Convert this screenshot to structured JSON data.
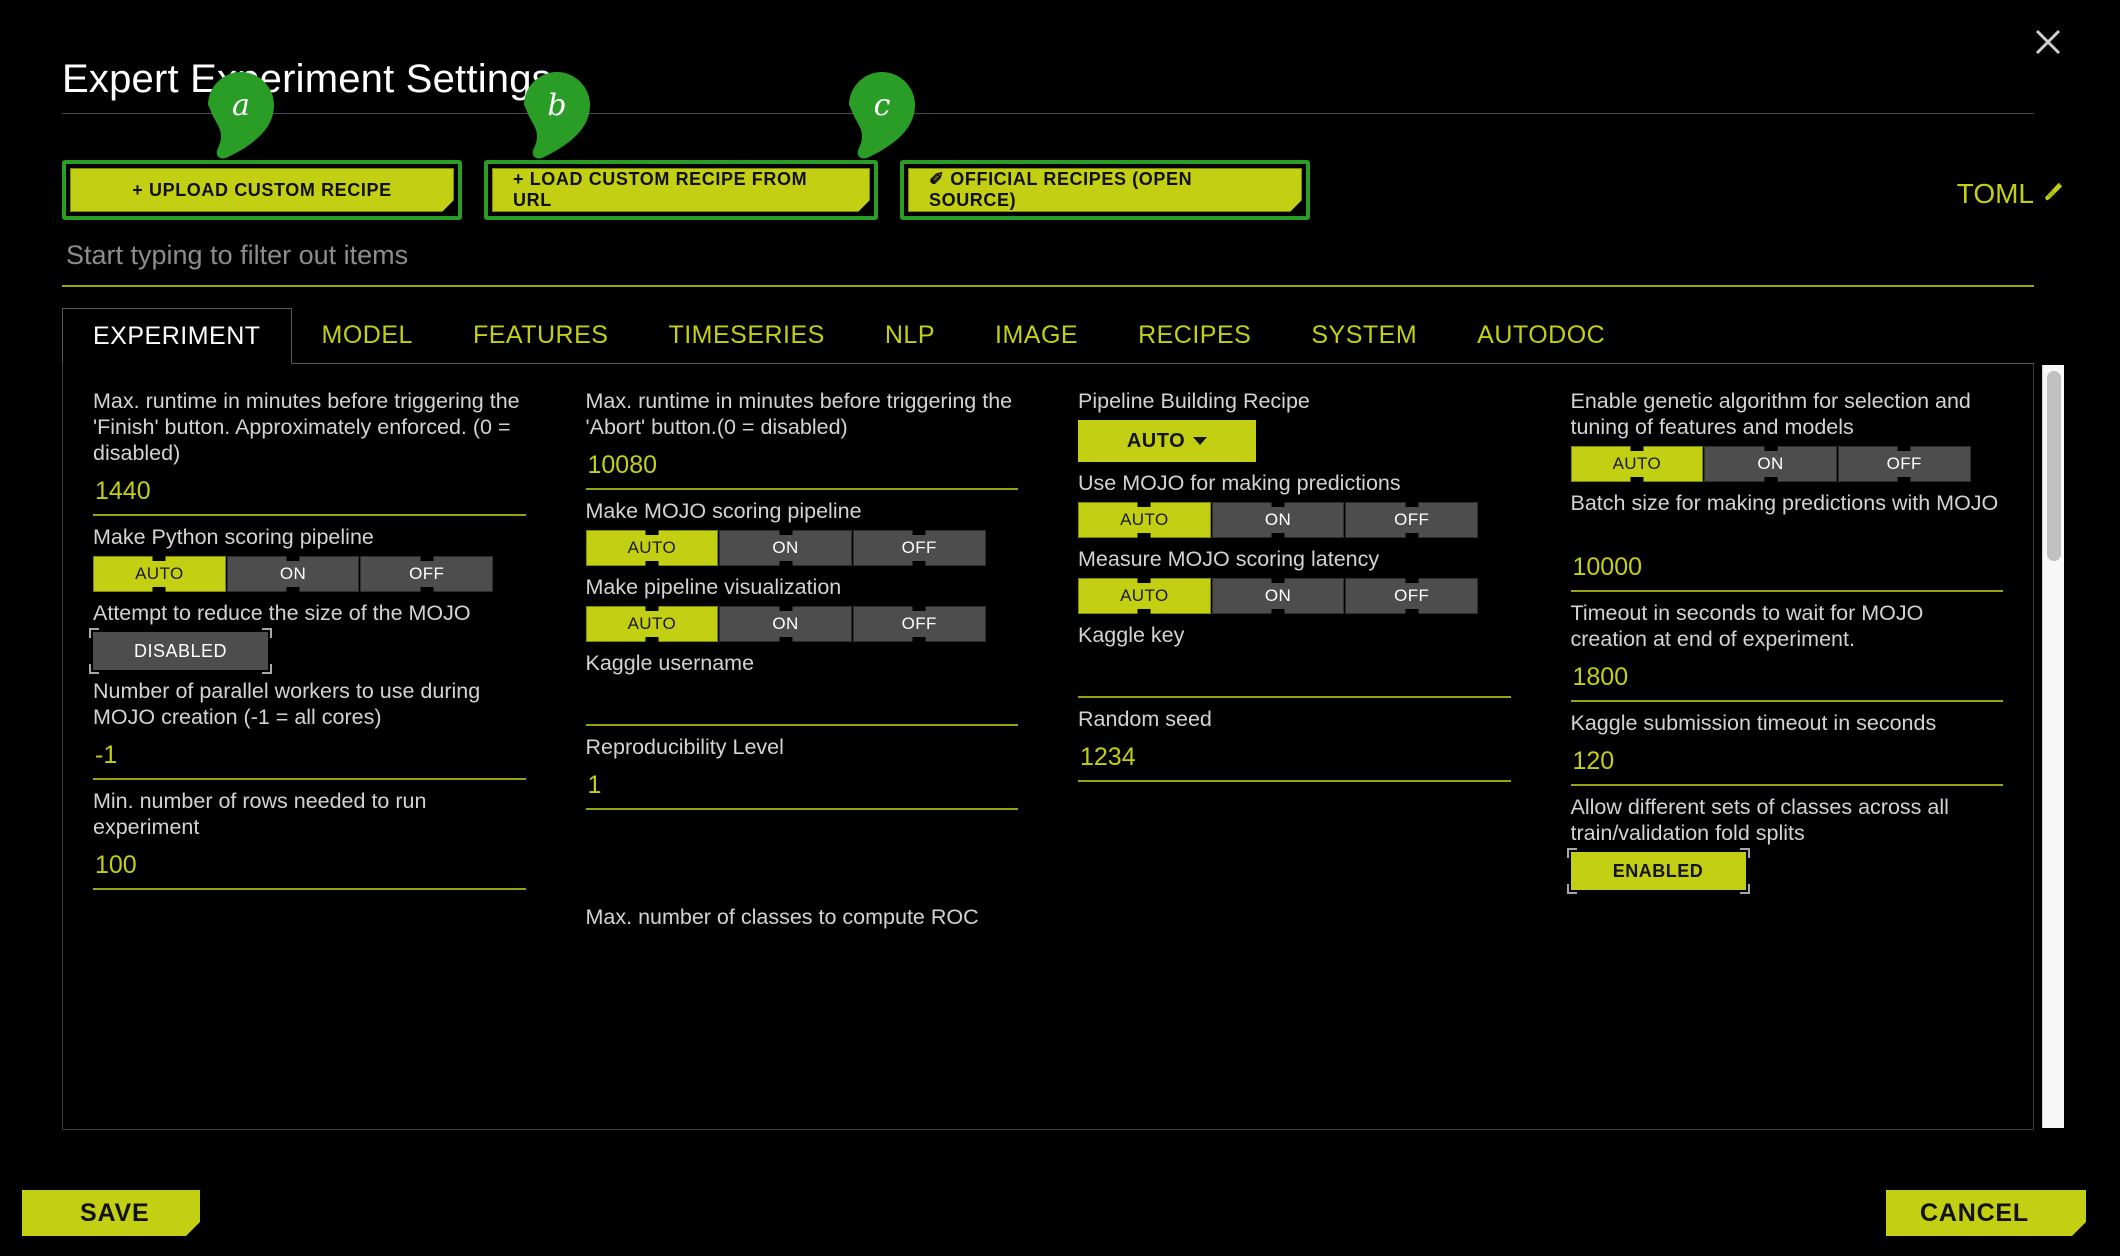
{
  "window": {
    "title": "Expert Experiment Settings",
    "close_icon": "close-icon"
  },
  "toolbar": {
    "recipe_buttons": [
      {
        "label": "+ UPLOAD CUSTOM RECIPE",
        "badge": "a"
      },
      {
        "label": "+ LOAD CUSTOM RECIPE FROM URL",
        "badge": "b"
      },
      {
        "label": "✐ OFFICIAL RECIPES (OPEN SOURCE)",
        "badge": "c"
      }
    ],
    "toml_label": "TOML",
    "toml_icon": "pencil-icon"
  },
  "search": {
    "placeholder": "Start typing to filter out items",
    "value": ""
  },
  "tabs": [
    {
      "label": "EXPERIMENT",
      "active": true
    },
    {
      "label": "MODEL",
      "active": false
    },
    {
      "label": "FEATURES",
      "active": false
    },
    {
      "label": "TIMESERIES",
      "active": false
    },
    {
      "label": "NLP",
      "active": false
    },
    {
      "label": "IMAGE",
      "active": false
    },
    {
      "label": "RECIPES",
      "active": false
    },
    {
      "label": "SYSTEM",
      "active": false
    },
    {
      "label": "AUTODOC",
      "active": false
    }
  ],
  "toggle_options": {
    "auto": "AUTO",
    "on": "ON",
    "off": "OFF"
  },
  "columns": [
    {
      "fields": [
        {
          "type": "text",
          "label": "Max. runtime in minutes before triggering the 'Finish' button. Approximately enforced. (0 = disabled)",
          "lines": 3,
          "value": "1440"
        },
        {
          "type": "tri",
          "label": "Make Python scoring pipeline",
          "lines": 1,
          "selected": "AUTO"
        },
        {
          "type": "pill",
          "label": "Attempt to reduce the size of the MOJO",
          "lines": 1,
          "value": "DISABLED",
          "state": "disabled"
        },
        {
          "type": "text",
          "label": "Number of parallel workers to use during MOJO creation (-1 = all cores)",
          "lines": 2,
          "value": "-1"
        },
        {
          "type": "text",
          "label": "Min. number of rows needed to run experiment",
          "lines": 2,
          "value": "100"
        }
      ],
      "cut_label": ""
    },
    {
      "fields": [
        {
          "type": "text",
          "label": "Max. runtime in minutes before triggering the 'Abort' button.(0 = disabled)",
          "lines": 2,
          "value": "10080"
        },
        {
          "type": "tri",
          "label": "Make MOJO scoring pipeline",
          "lines": 1,
          "selected": "AUTO"
        },
        {
          "type": "tri",
          "label": "Make pipeline visualization",
          "lines": 1,
          "selected": "AUTO"
        },
        {
          "type": "text",
          "label": "Kaggle username",
          "lines": 1,
          "value": ""
        },
        {
          "type": "text",
          "label": "Reproducibility Level",
          "lines": 1,
          "value": "1"
        }
      ],
      "cut_label": "Max. number of classes to compute ROC"
    },
    {
      "fields": [
        {
          "type": "dropdown",
          "label": "Pipeline Building Recipe",
          "lines": 1,
          "value": "AUTO"
        },
        {
          "type": "tri",
          "label": "Use MOJO for making predictions",
          "lines": 1,
          "selected": "AUTO"
        },
        {
          "type": "tri",
          "label": "Measure MOJO scoring latency",
          "lines": 1,
          "selected": "AUTO"
        },
        {
          "type": "text",
          "label": "Kaggle key",
          "lines": 1,
          "value": ""
        },
        {
          "type": "text",
          "label": "Random seed",
          "lines": 1,
          "value": "1234"
        }
      ],
      "cut_label": ""
    },
    {
      "fields": [
        {
          "type": "tri",
          "label": "Enable genetic algorithm for selection and tuning of features and models",
          "lines": 2,
          "selected": "AUTO"
        },
        {
          "type": "text",
          "label": "Batch size for making predictions with MOJO",
          "lines": 2,
          "value": "10000"
        },
        {
          "type": "text",
          "label": "Timeout in seconds to wait for MOJO creation at end of experiment.",
          "lines": 2,
          "value": "1800"
        },
        {
          "type": "text",
          "label": "Kaggle submission timeout in seconds",
          "lines": 1,
          "value": "120"
        },
        {
          "type": "pill",
          "label": "Allow different sets of classes across all train/validation fold splits",
          "lines": 2,
          "value": "ENABLED",
          "state": "enabled"
        }
      ],
      "cut_label": ""
    }
  ],
  "footer": {
    "save_label": "SAVE",
    "cancel_label": "CANCEL"
  },
  "colors": {
    "accent": "#c3cf12",
    "badge_green": "#2a9d26",
    "toggle_off": "#4d4d4d",
    "background": "#000000",
    "label_text": "#d3d3d3"
  }
}
